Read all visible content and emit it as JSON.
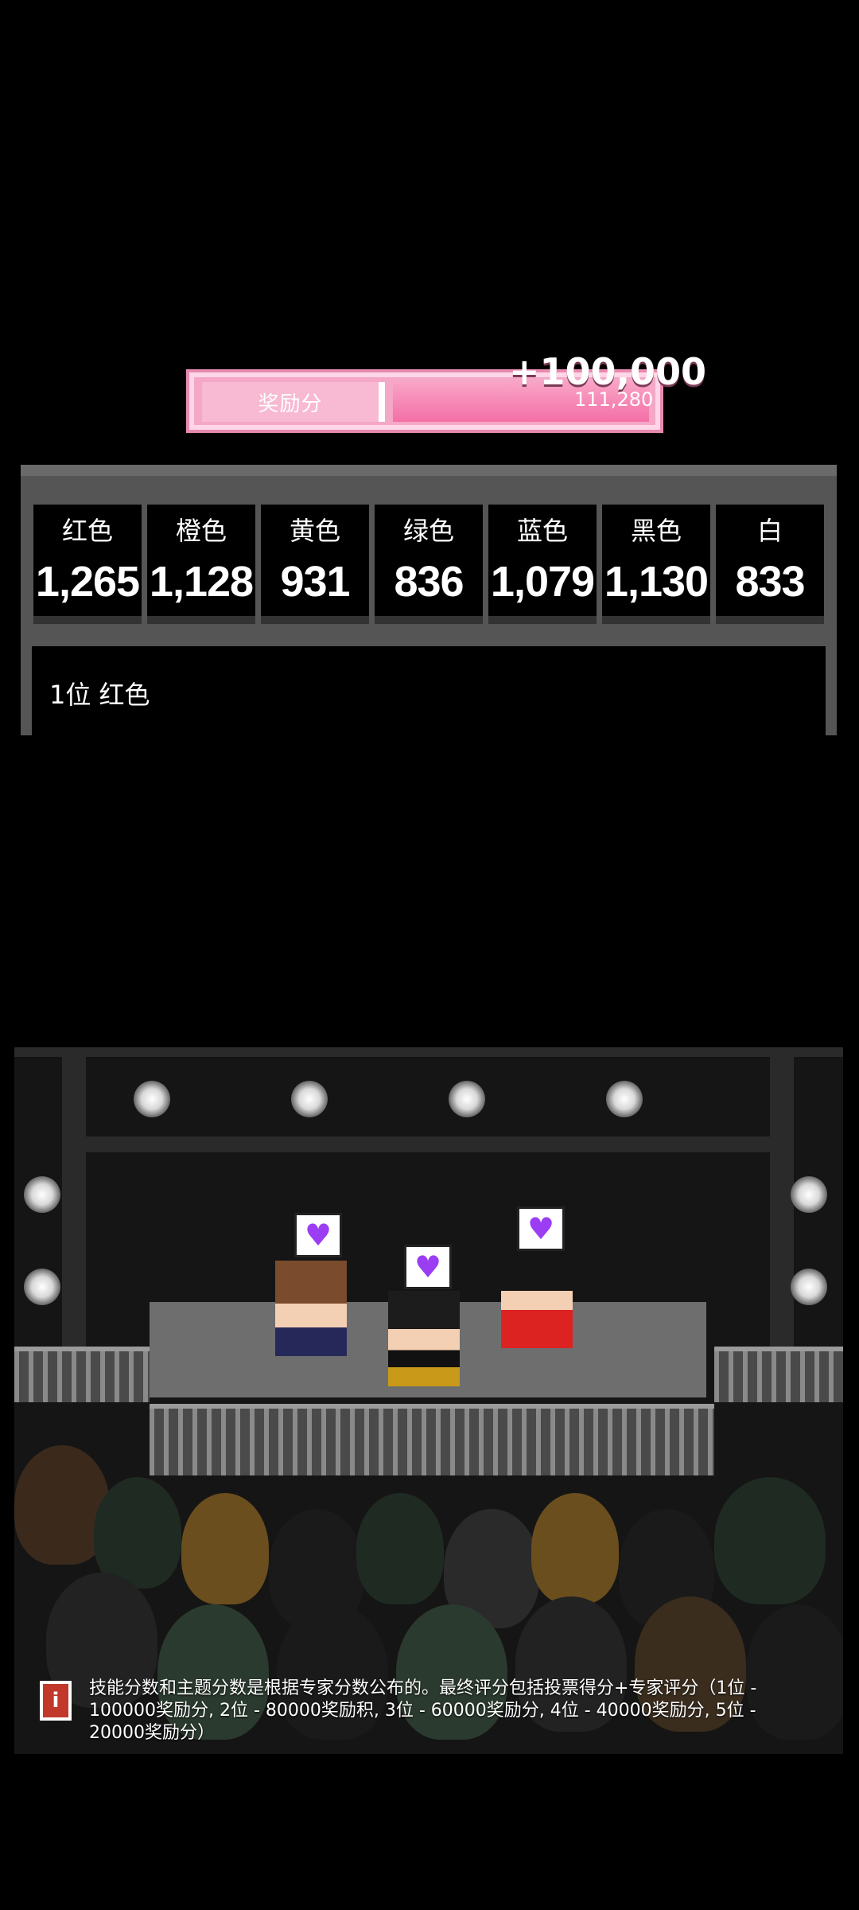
{
  "bonus": {
    "label": "奖励分",
    "big_value": "+100,000",
    "total": "111,280"
  },
  "scores": [
    {
      "name": "红色",
      "value": "1,265"
    },
    {
      "name": "橙色",
      "value": "1,128"
    },
    {
      "name": "黄色",
      "value": "931"
    },
    {
      "name": "绿色",
      "value": "836"
    },
    {
      "name": "蓝色",
      "value": "1,079"
    },
    {
      "name": "黑色",
      "value": "1,130"
    },
    {
      "name": "白",
      "value": "833"
    }
  ],
  "rank_text": "1位 红色",
  "info_text": "技能分数和主题分数是根据专家分数公布的。最终评分包括投票得分+专家评分（1位 - 100000奖励分, 2位 - 80000奖励积, 3位 - 60000奖励分, 4位 - 40000奖励分, 5位 - 20000奖励分）",
  "icons": {
    "heart": "♥",
    "info": "i"
  },
  "colors": {
    "bonus_pink": "#f4a7c6",
    "heart_purple": "#9b3df2",
    "panel_gray": "#555555"
  }
}
